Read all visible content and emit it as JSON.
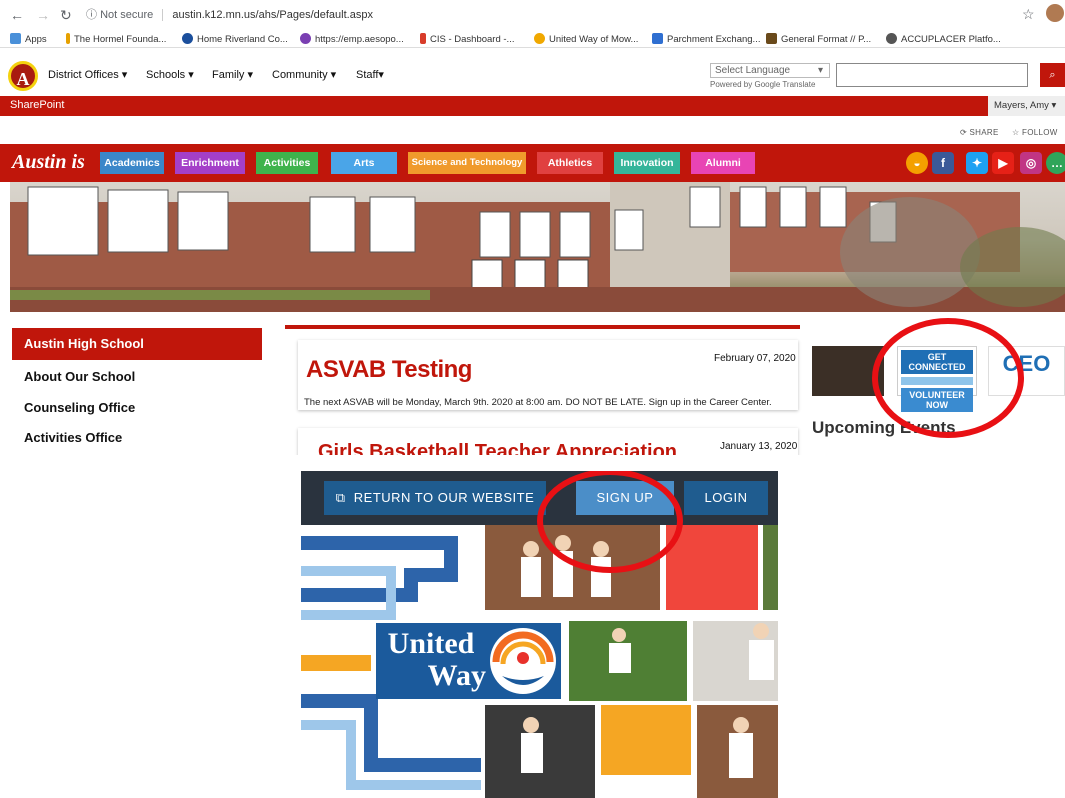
{
  "browser": {
    "security_label": "Not secure",
    "url": "austin.k12.mn.us/ahs/Pages/default.aspx",
    "bookmarks": [
      {
        "label": "Apps",
        "color": "#4a90d9"
      },
      {
        "label": "The Hormel Founda...",
        "color": "#e6a100"
      },
      {
        "label": "Home Riverland Co...",
        "color": "#1b4f9c"
      },
      {
        "label": "https://emp.aesopo...",
        "color": "#7a3fb2"
      },
      {
        "label": "CIS - Dashboard -...",
        "color": "#d83c2a"
      },
      {
        "label": "United Way of Mow...",
        "color": "#f0a800"
      },
      {
        "label": "Parchment Exchang...",
        "color": "#2f6fd1"
      },
      {
        "label": "General Format // P...",
        "color": "#6a4a1b"
      },
      {
        "label": "ACCUPLACER Platfo...",
        "color": "#555555"
      }
    ]
  },
  "sharepoint": {
    "top_nav": [
      "District Offices ▾",
      "Schools ▾",
      "Family ▾",
      "Community ▾",
      "Staff▾"
    ],
    "language_select": "Select Language",
    "powered_by": "Powered by Google Translate",
    "bar_label": "SharePoint",
    "user_name": "Mayers, Amy ▾",
    "share_label": "SHARE",
    "follow_label": "FOLLOW",
    "tagline": "Austin is",
    "categories": [
      {
        "label": "Academics",
        "color": "#3b87c9"
      },
      {
        "label": "Enrichment",
        "color": "#a43fc8"
      },
      {
        "label": "Activities",
        "color": "#3fb34c"
      },
      {
        "label": "Arts",
        "color": "#4aa5e8"
      },
      {
        "label": "Science and Technology",
        "color": "#f09a2c"
      },
      {
        "label": "Athletics",
        "color": "#e04040"
      },
      {
        "label": "Innovation",
        "color": "#35b59a"
      },
      {
        "label": "Alumni",
        "color": "#e844b4"
      }
    ],
    "sidebar": {
      "heading": "Austin High School",
      "items": [
        "About Our School",
        "Counseling Office",
        "Activities Office"
      ]
    },
    "news": [
      {
        "title": "ASVAB Testing",
        "date": "February 07, 2020",
        "body": "The next ASVAB will be Monday, March 9th. 2020 at 8:00 am. DO NOT BE LATE. Sign up in the Career Center."
      },
      {
        "title": "Girls Basketball Teacher Appreciation",
        "date": "January 13, 2020"
      }
    ],
    "partners": {
      "get_connected_top": "GET CONNECTED",
      "get_connected_bottom": "VOLUNTEER NOW",
      "ceo": "CEO"
    },
    "upcoming_events": "Upcoming Events"
  },
  "united_way": {
    "return_label": "RETURN TO OUR WEBSITE",
    "signup_label": "SIGN UP",
    "login_label": "LOGIN",
    "logo_line1": "United",
    "logo_line2": "Way"
  }
}
